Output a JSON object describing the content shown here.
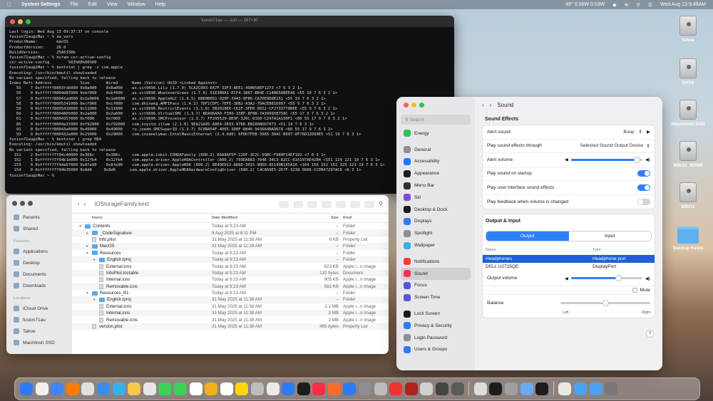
{
  "menubar": {
    "app_name": "System Settings",
    "menus": [
      "File",
      "Edit",
      "View",
      "Window",
      "Help"
    ],
    "stats": "49° 0.56W 0.53W",
    "datetime": "Wed Aug 13  9:49AM"
  },
  "desktop": {
    "icons": [
      "Tahoe",
      "DATA",
      "Macintosh SSD",
      "WIN10_NVME",
      "WIN11",
      "Backup Kexts"
    ]
  },
  "terminal": {
    "title": "fusion71au — -zsh — 167×30",
    "lines": [
      "Last login: Wed Aug 13 09:37:37 on console",
      "fusion71au@iMac ~ % sw_vers",
      "ProductName:        macOS",
      "ProductVersion:     26.0",
      "BuildVersion:       25A5338b",
      "fusion71au@iMac ~ % nvram csr-active-config",
      "csr-active-config        %03%08%00%00",
      "fusion71au@iMac ~ % kextstat | grep -v com.apple",
      "Executing: /usr/bin/kmutil showloaded",
      "No variant specified, falling back to release",
      "Index Refs Address            Size       Wired      Name (Version) UUID <Linked Against>",
      "   55    7 0xffffff8003fdb000 0x8a000    0x8a000    as.vit9696.Lilu (1.7.0) 5CA2C003-EA7F-33F3-8EE1-490058EF1273 <7 6 3 2 1>",
      "   56    0 0xffffff8004d8f000 0xbf000    0xbf000    as.vit9696.WhateverGreen (1.7.0) 51E3B8A1-ECF4-3867-BB4E-C14B058BEE46 <55 19 7 6 3 2 1>",
      "   57    0 0xffffff80041ad000 0x1e0000   0x1e0000   as.vit9696.AppleALC (1.9.5) 6BE0BE61-920F-3943-8FB0-CA7DE9D0E251 <55 19 7 6 3 2 1>",
      "   58    0 0xffffff8005341000 0xcf000    0xcf000    com.dhinakg.AMFIPass (1.4.1) 7DF1CDFC-7EFE-3DB2-A3A2-7DACEB81D097 <55 9 7 6 3 2 1>",
      "   59    0 0xffffff8005410000 0x11000    0x11000    as.vit9696.RestrictEvents (1.1.6) 5B2028EE-C62F-3FE0-9022-CF2733778BEE <55 9 7 6 3 2 1>",
      "   60    2 0xffffff8004865000 0x2a000    0x2a000    as.vit9696.VirtualSMC (1.3.7) BEA66AA0-F399-338F-8F8B-7A39995B758C <55 17 9 7 6 3 2 1>",
      "   61    0 0xffffff8004357000 0xf000     0xf000     as.vit9696.SMCProcessor (1.3.7) FF295529-8E9F-320C-8168-C247A1A150F1 <60 55 17 9 7 6 3 2 1>",
      "   85    0 0xffffff8004a3f000 0xf92000   0xf92000   com.zxystd.itlwm (2.1.0) 9EA21A95-A8E4-3E03-976D-EB1808DD7073 <51 19 7 6 3 1>",
      "   91    0 0xffffff80043e6000 0x49000    0x49000    ru.joedm.SMCSuperIO (1.3.7) 5C6BA54F-40E5-3D8F-8846-943664BAD6C8 <60 55 17 9 7 6 3 2>",
      "   93    0 0xffffff800432e000 0x29000    0x29000    com.insanelymac.IntelMausiEthernet (2.4.0d0) 6FDD7FEB-3965-3DAC-B997-8F76D32D99E5 <51 19 7 6 3 1>",
      "fusion71au@iMac ~ % kextstat | grep HDA",
      "Executing: /usr/bin/kmutil showloaded",
      "No variant specified, falling back to release",
      "  151    2 0xffffff7f94c40000 0x366c     0x366c     com.apple.iokit.IOHDAFamily (600.2) 66A8AF5F-126F-3C2C-95BC-F980F14EF182 <7 6 3 1>",
      "  152    1 0xffffff7f94b1e000 0x12fb4    0x12fb4    com.apple.driver.AppleHDAController (600.2) 759DA883-704E-34C3-82CC-616197AE42B4 <151 129 121 19 7 6 3 1>",
      "  153    0 0xffffff7f94a67000 0x8fe90    0x8fe90    com.apple.driver.AppleHDA (600.2) 8E40ED12-AD6D-3015-9DD0-85149B145A2A <164 156 152 151 129 121 19 7 6 3 1>",
      "  154    0 0xffffff7f94b35000 0x8d6     0x8d6      com.apple.driver.AppleHDAHardwareConfigDriver (600.2) C4C8A9E5-267F-3238-9806-CCDB47297AC6 <6 3 1>",
      "fusion71au@iMac ~ % "
    ]
  },
  "finder": {
    "path": "IOStorageFamily.kext",
    "sidebar": {
      "favorites": [
        "Recents",
        "Shared"
      ],
      "favorites_header": "Favorites",
      "favorites2": [
        "Applications",
        "Desktop",
        "Documents",
        "Downloads"
      ],
      "locations_header": "Locations",
      "locations": [
        "iCloud Drive",
        "fusion71au",
        "Tahoe",
        "Macintosh SSD"
      ]
    },
    "columns": [
      "Name",
      "Date Modified",
      "Size",
      "Kind"
    ],
    "rows": [
      {
        "d": 0,
        "t": "folder",
        "open": true,
        "n": "Contents",
        "m": "Today at 9:23 AM",
        "s": "--",
        "k": "Folder"
      },
      {
        "d": 1,
        "t": "folder",
        "open": false,
        "n": "_CodeSignature",
        "m": "8 Aug 2025 at 6:11 PM",
        "s": "--",
        "k": "Folder"
      },
      {
        "d": 1,
        "t": "file",
        "n": "Info.plist",
        "m": "31 May 2025 at 11:38 AM",
        "s": "6 KB",
        "k": "Property List"
      },
      {
        "d": 1,
        "t": "folder",
        "open": false,
        "n": "MacOS",
        "m": "31 May 2025 at 11:39 AM",
        "s": "--",
        "k": "Folder"
      },
      {
        "d": 1,
        "t": "folder",
        "open": true,
        "n": "Resources",
        "m": "Today at 9:23 AM",
        "s": "--",
        "k": "Folder"
      },
      {
        "d": 2,
        "t": "folder",
        "open": false,
        "n": "English.lproj",
        "m": "Today at 9:23 AM",
        "s": "--",
        "k": "Folder"
      },
      {
        "d": 2,
        "t": "file",
        "n": "External.icns",
        "m": "Today at 9:23 AM",
        "s": "623 KB",
        "k": "Apple i...n image"
      },
      {
        "d": 2,
        "t": "file",
        "n": "InfoPlist.loctable",
        "m": "Today at 9:23 AM",
        "s": "132 bytes",
        "k": "Document"
      },
      {
        "d": 2,
        "t": "file",
        "n": "Internal.icns",
        "m": "Today at 9:23 AM",
        "s": "905 KB",
        "k": "Apple i...n image"
      },
      {
        "d": 2,
        "t": "file",
        "n": "Removable.icns",
        "m": "Today at 9:23 AM",
        "s": "562 KB",
        "k": "Apple i...n image"
      },
      {
        "d": 1,
        "t": "folder",
        "open": true,
        "n": "Resources_B1",
        "m": "Today at 9:23 AM",
        "s": "--",
        "k": "Folder"
      },
      {
        "d": 2,
        "t": "folder",
        "open": false,
        "n": "English.lproj",
        "m": "31 May 2025 at 11:38 AM",
        "s": "--",
        "k": "Folder"
      },
      {
        "d": 2,
        "t": "file",
        "n": "External.icns",
        "m": "31 May 2025 at 11:38 AM",
        "s": "2.1 MB",
        "k": "Apple i...n image"
      },
      {
        "d": 2,
        "t": "file",
        "n": "Internal.icns",
        "m": "31 May 2025 at 11:38 AM",
        "s": "2 MB",
        "k": "Apple i...n image"
      },
      {
        "d": 2,
        "t": "file",
        "n": "Removable.icns",
        "m": "31 May 2025 at 11:38 AM",
        "s": "2 MB",
        "k": "Apple i...n image"
      },
      {
        "d": 1,
        "t": "file",
        "n": "version.plist",
        "m": "31 May 2025 at 11:38 AM",
        "s": "465 bytes",
        "k": "Property List"
      }
    ]
  },
  "settings": {
    "search_placeholder": "Search",
    "sidebar": [
      {
        "label": "Energy",
        "color": "#31c05a"
      },
      {
        "gap": true
      },
      {
        "label": "General",
        "color": "#8e8e93"
      },
      {
        "label": "Accessibility",
        "color": "#1a7cf5"
      },
      {
        "label": "Appearance",
        "color": "#1c1c1e"
      },
      {
        "label": "Menu Bar",
        "color": "#2f2f33"
      },
      {
        "label": "Siri",
        "color": "#7b4dd6"
      },
      {
        "label": "Desktop & Dock",
        "color": "#1c1c1e"
      },
      {
        "label": "Displays",
        "color": "#2e7cf6"
      },
      {
        "label": "Spotlight",
        "color": "#8e8e93"
      },
      {
        "label": "Wallpaper",
        "color": "#3ab0e8"
      },
      {
        "gap": true
      },
      {
        "label": "Notifications",
        "color": "#ff3b30"
      },
      {
        "label": "Sound",
        "color": "#ff2d55",
        "selected": true
      },
      {
        "label": "Focus",
        "color": "#5856d6"
      },
      {
        "label": "Screen Time",
        "color": "#5856d6"
      },
      {
        "gap": true
      },
      {
        "label": "Lock Screen",
        "color": "#1c1c1e"
      },
      {
        "label": "Privacy & Security",
        "color": "#2e7cf6"
      },
      {
        "label": "Login Password",
        "color": "#8e8e93"
      },
      {
        "label": "Users & Groups",
        "color": "#2e7cf6"
      }
    ],
    "page_title": "Sound",
    "sound_effects": {
      "title": "Sound Effects",
      "alert_sound_label": "Alert sound",
      "alert_sound_value": "Boop",
      "play_through_label": "Play sound effects through",
      "play_through_value": "Selected Sound Output Device",
      "alert_volume_label": "Alert volume",
      "alert_volume": 0.92,
      "startup_label": "Play sound on startup",
      "startup_on": true,
      "ui_sounds_label": "Play user interface sound effects",
      "ui_sounds_on": true,
      "feedback_label": "Play feedback when volume is changed",
      "feedback_on": false
    },
    "output_input": {
      "title": "Output & Input",
      "tab_output": "Output",
      "tab_input": "Input",
      "col_name": "Name",
      "col_type": "Type",
      "devices": [
        {
          "name": "Headphones",
          "type": "Headphone port",
          "selected": true
        },
        {
          "name": "DELL U2725QE",
          "type": "DisplayPort",
          "selected": false
        }
      ],
      "output_volume_label": "Output volume",
      "output_volume": 0.66,
      "mute_label": "Mute",
      "balance_label": "Balance",
      "balance": 0.5,
      "left_label": "Left",
      "right_label": "Right"
    }
  },
  "dock": {
    "colors": [
      "#2d7cf6",
      "#f0f0f0",
      "#4285f4",
      "#ff7b00",
      "#e0e0e0",
      "#3c8cf0",
      "#3ab0e8",
      "#f6c94a",
      "#e5e5e5",
      "#3cd15a",
      "#3cd15a",
      "#ffffff",
      "#f2b01e",
      "#ffffff",
      "#ffd60a",
      "#bdbdbd",
      "#eaeaea",
      "#2d7cf6",
      "#1c1c1e",
      "#fa2d48",
      "#f56d2a",
      "#2d7cf6",
      "#8e8e93",
      "#bbbbbb",
      "#e33",
      "#b0201e",
      "#d0d0d0",
      "#444",
      "#5a5a5a",
      "#ddd",
      "#1c1c1e",
      "#9f9f9f",
      "#6aa9f0",
      "#1c1c1e",
      "#e8e8e8",
      "#4aa3f0",
      "#4aa3f0",
      "#777"
    ]
  }
}
